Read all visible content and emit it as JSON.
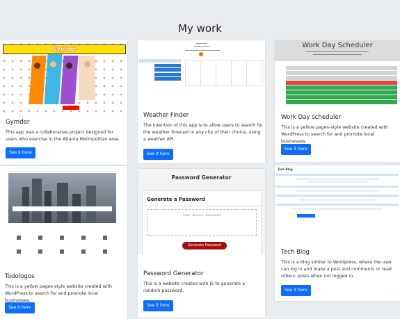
{
  "page": {
    "title": "My work"
  },
  "colors": {
    "accent": "#0d6efd",
    "page_bg": "#e9ecef",
    "gymder_banner": "#ffe200",
    "scheduler_green": "#2fa84f",
    "scheduler_red": "#e04444",
    "scheduler_gray": "#d3d3d3",
    "pw_button": "#a80e0e"
  },
  "projects": [
    {
      "title": "Gymder",
      "description": "This app was a collaborative project designed for users who exercise in the Atlanta Metropolitan area.",
      "button": "See it here",
      "thumb_label": "Gymder"
    },
    {
      "title": "Weather Finder",
      "description": "The intention of this app is to allow users to search for the weather forecast in any city of their choice, using a weather API.",
      "button": "See it here"
    },
    {
      "title": "Work Day scheduler",
      "description": "This is a yellow pages-style website created with WordPress to search for and promote local businesses.",
      "button": "See it here",
      "thumb_title": "Work Day Scheduler"
    },
    {
      "title": "Todologos",
      "description": "This is a yellow pages-style website created with WordPress to search for and promote local businesses.",
      "button": "See it here"
    },
    {
      "title": "Password Generator",
      "description": "This is a website created with JS to generate a random password.",
      "button": "See it here",
      "thumb_heading": "Password Generator",
      "thumb_subheading": "Generate a Password",
      "thumb_placeholder": "Your Secure Password",
      "thumb_button": "Generate Password"
    },
    {
      "title": "Tech Blog",
      "description": "This is a blog similar to Wordpress, where the user can log in and make a post and comments or read others' posts when not logged in.",
      "button": "See it here",
      "thumb_header": "Tech Blog"
    }
  ]
}
